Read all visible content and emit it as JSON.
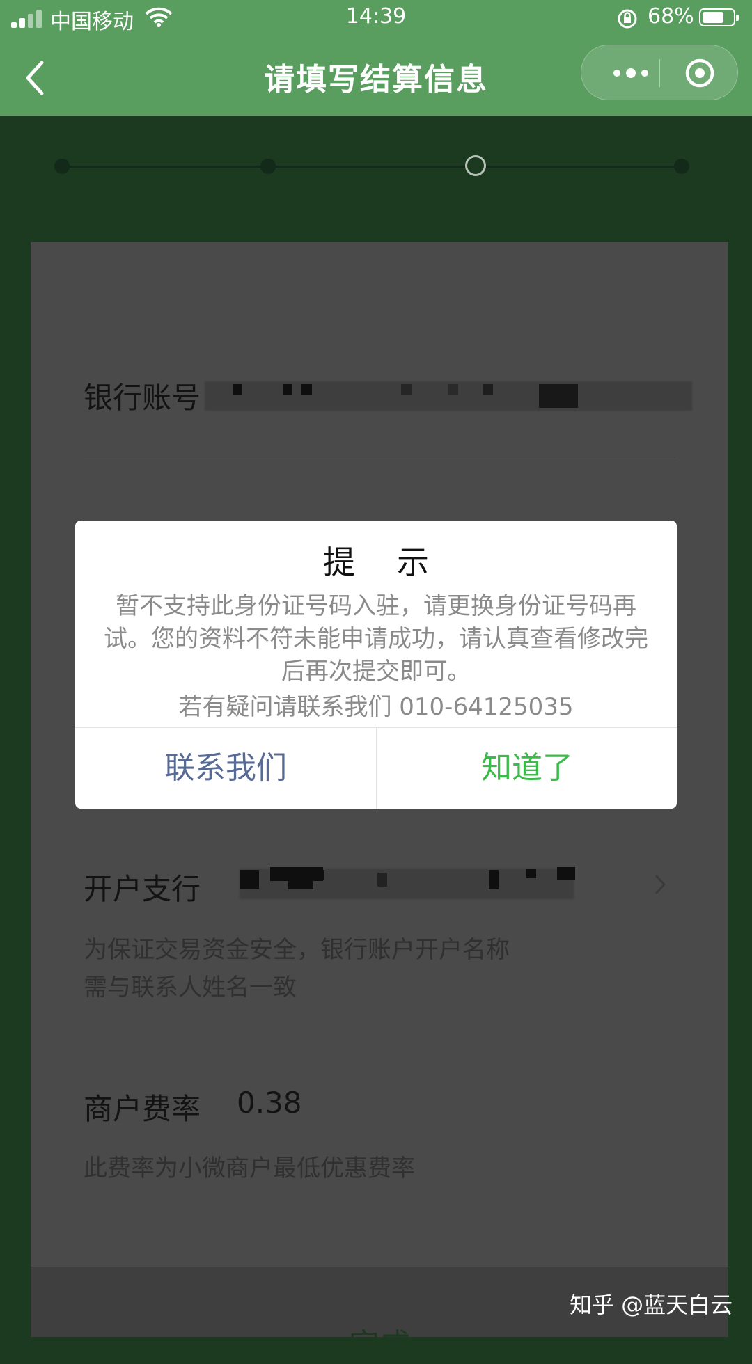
{
  "status_bar": {
    "carrier": "中国移动",
    "time": "14:39",
    "battery": "68%",
    "battery_level": 0.68
  },
  "nav": {
    "title": "请填写结算信息"
  },
  "progress": {
    "steps": 4,
    "current_step": 3
  },
  "form": {
    "bank_account_label": "银行账号",
    "bank_branch_label": "开户支行",
    "account_hint": "为保证交易资金安全，银行账户开户名称需与联系人姓名一致",
    "fee_label": "商户费率",
    "fee_value": "0.38",
    "fee_hint": "此费率为小微商户最低优惠费率"
  },
  "dialog": {
    "title": "提示",
    "message": "暂不支持此身份证号码入驻，请更换身份证号码再试。您的资料不符未能申请成功，请认真查看修改完后再次提交即可。",
    "contact": "若有疑问请联系我们 010-64125035",
    "contact_button": "联系我们",
    "ok_button": "知道了"
  },
  "watermark": "知乎 @蓝天白云",
  "colors": {
    "nav_green": "#599e5f",
    "ok_green": "#3cbb4a",
    "contact_blue": "#586b94"
  }
}
